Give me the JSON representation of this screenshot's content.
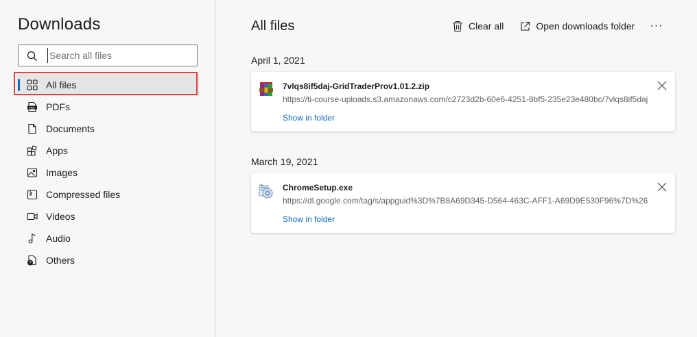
{
  "sidebar": {
    "title": "Downloads",
    "search": {
      "placeholder": "Search all files",
      "value": ""
    },
    "items": [
      {
        "label": "All files",
        "icon": "grid-icon",
        "active": true
      },
      {
        "label": "PDFs",
        "icon": "pdf-icon"
      },
      {
        "label": "Documents",
        "icon": "document-icon"
      },
      {
        "label": "Apps",
        "icon": "apps-icon"
      },
      {
        "label": "Images",
        "icon": "image-icon"
      },
      {
        "label": "Compressed files",
        "icon": "compressed-icon"
      },
      {
        "label": "Videos",
        "icon": "video-icon"
      },
      {
        "label": "Audio",
        "icon": "audio-icon"
      },
      {
        "label": "Others",
        "icon": "other-icon"
      }
    ]
  },
  "main": {
    "title": "All files",
    "toolbar": {
      "clear_all": "Clear all",
      "open_folder": "Open downloads folder",
      "more": "···"
    },
    "groups": [
      {
        "date": "April 1, 2021",
        "files": [
          {
            "name": "7vlqs8if5daj-GridTraderProv1.01.2.zip",
            "url": "https://ti-course-uploads.s3.amazonaws.com/c2723d2b-60e6-4251-8bf5-235e23e480bc/7vlqs8if5daj",
            "action": "Show in folder",
            "icon": "archive-icon"
          }
        ]
      },
      {
        "date": "March 19, 2021",
        "files": [
          {
            "name": "ChromeSetup.exe",
            "url": "https://dl.google.com/tag/s/appguid%3D%7B8A69D345-D564-463C-AFF1-A69D9E530F96%7D%26",
            "action": "Show in folder",
            "icon": "installer-icon"
          }
        ]
      }
    ]
  },
  "colors": {
    "accent": "#0f6cbd",
    "highlight_border": "#e04343",
    "active_bg": "#e5e5e5"
  }
}
